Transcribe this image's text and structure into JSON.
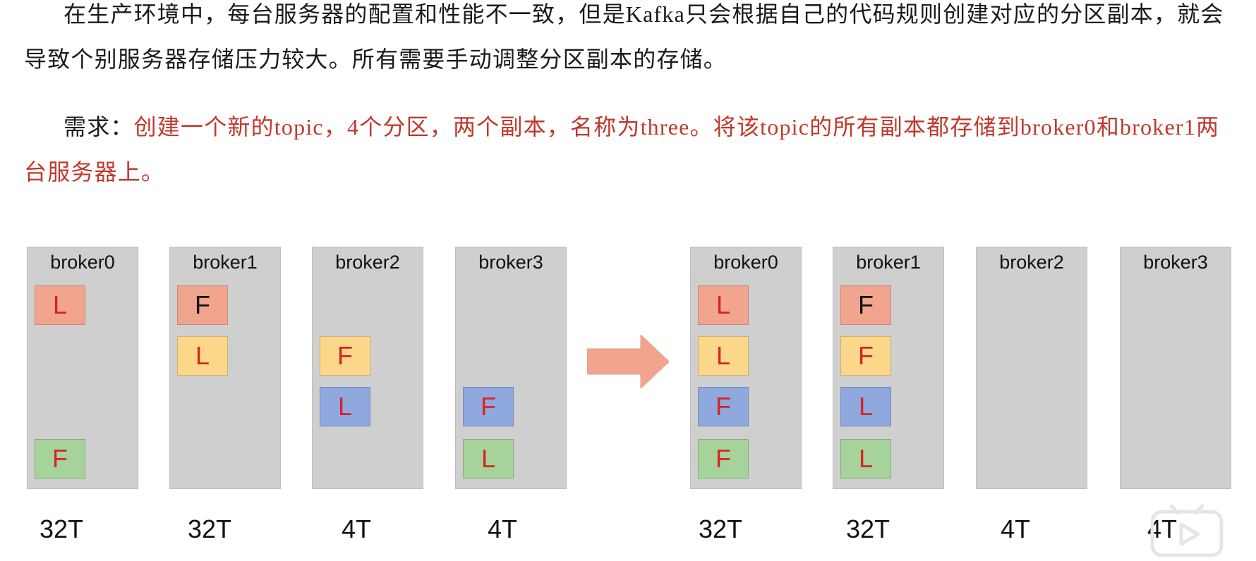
{
  "paragraph1": "在生产环境中，每台服务器的配置和性能不一致，但是Kafka只会根据自己的代码规则创建对应的分区副本，就会导致个别服务器存储压力较大。所有需要手动调整分区副本的存储。",
  "requirement": {
    "label": "需求：",
    "text": "创建一个新的topic，4个分区，两个副本，名称为three。将该topic的所有副本都存储到broker0和broker1两台服务器上。"
  },
  "colors": {
    "red": "#F2A58E",
    "yellow": "#FBD889",
    "blue": "#8FA9DE",
    "green": "#A6D39A",
    "text_red": "#D62424",
    "text_black": "#111111",
    "arrow": "#F2A58E",
    "broker_bg": "#cfcfcf"
  },
  "before": {
    "brokers": [
      {
        "name": "broker0",
        "capacity": "32T",
        "replicas": [
          {
            "label": "L",
            "color": "red",
            "slot": 0
          },
          {
            "label": "F",
            "color": "green",
            "slot": 3
          }
        ]
      },
      {
        "name": "broker1",
        "capacity": "32T",
        "replicas": [
          {
            "label": "F",
            "color": "red",
            "slot": 0
          },
          {
            "label": "L",
            "color": "yellow",
            "slot": 1
          }
        ]
      },
      {
        "name": "broker2",
        "capacity": "4T",
        "replicas": [
          {
            "label": "F",
            "color": "yellow",
            "slot": 1
          },
          {
            "label": "L",
            "color": "blue",
            "slot": 2
          }
        ]
      },
      {
        "name": "broker3",
        "capacity": "4T",
        "replicas": [
          {
            "label": "F",
            "color": "blue",
            "slot": 2
          },
          {
            "label": "L",
            "color": "green",
            "slot": 3
          }
        ]
      }
    ]
  },
  "after": {
    "brokers": [
      {
        "name": "broker0",
        "capacity": "32T",
        "replicas": [
          {
            "label": "L",
            "color": "red",
            "slot": 0
          },
          {
            "label": "L",
            "color": "yellow",
            "slot": 1
          },
          {
            "label": "F",
            "color": "blue",
            "slot": 2
          },
          {
            "label": "F",
            "color": "green",
            "slot": 3
          }
        ]
      },
      {
        "name": "broker1",
        "capacity": "32T",
        "replicas": [
          {
            "label": "F",
            "color": "red",
            "slot": 0
          },
          {
            "label": "F",
            "color": "yellow",
            "slot": 1
          },
          {
            "label": "L",
            "color": "blue",
            "slot": 2
          },
          {
            "label": "L",
            "color": "green",
            "slot": 3
          }
        ]
      },
      {
        "name": "broker2",
        "capacity": "4T",
        "replicas": []
      },
      {
        "name": "broker3",
        "capacity": "4T",
        "replicas": []
      }
    ]
  },
  "icons": {
    "arrow": "right-arrow-icon",
    "watermark": "play-tv-icon"
  }
}
